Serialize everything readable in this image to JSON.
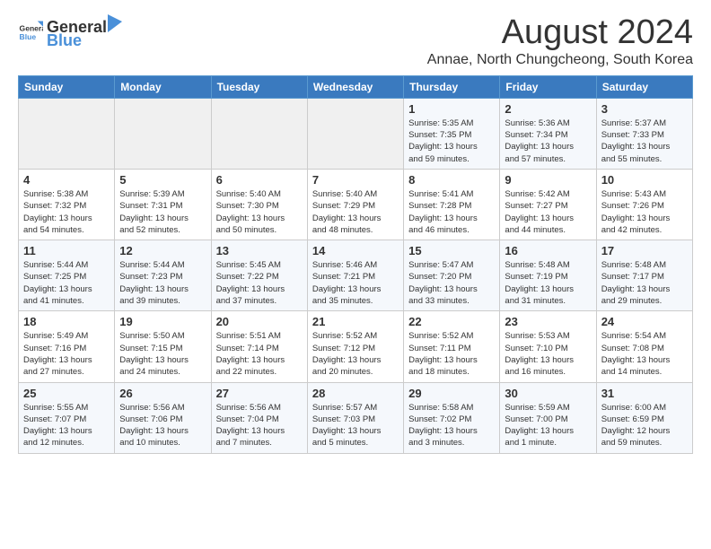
{
  "header": {
    "logo_general": "General",
    "logo_blue": "Blue",
    "month_title": "August 2024",
    "location": "Annae, North Chungcheong, South Korea"
  },
  "weekdays": [
    "Sunday",
    "Monday",
    "Tuesday",
    "Wednesday",
    "Thursday",
    "Friday",
    "Saturday"
  ],
  "weeks": [
    [
      {
        "day": "",
        "info": ""
      },
      {
        "day": "",
        "info": ""
      },
      {
        "day": "",
        "info": ""
      },
      {
        "day": "",
        "info": ""
      },
      {
        "day": "1",
        "info": "Sunrise: 5:35 AM\nSunset: 7:35 PM\nDaylight: 13 hours\nand 59 minutes."
      },
      {
        "day": "2",
        "info": "Sunrise: 5:36 AM\nSunset: 7:34 PM\nDaylight: 13 hours\nand 57 minutes."
      },
      {
        "day": "3",
        "info": "Sunrise: 5:37 AM\nSunset: 7:33 PM\nDaylight: 13 hours\nand 55 minutes."
      }
    ],
    [
      {
        "day": "4",
        "info": "Sunrise: 5:38 AM\nSunset: 7:32 PM\nDaylight: 13 hours\nand 54 minutes."
      },
      {
        "day": "5",
        "info": "Sunrise: 5:39 AM\nSunset: 7:31 PM\nDaylight: 13 hours\nand 52 minutes."
      },
      {
        "day": "6",
        "info": "Sunrise: 5:40 AM\nSunset: 7:30 PM\nDaylight: 13 hours\nand 50 minutes."
      },
      {
        "day": "7",
        "info": "Sunrise: 5:40 AM\nSunset: 7:29 PM\nDaylight: 13 hours\nand 48 minutes."
      },
      {
        "day": "8",
        "info": "Sunrise: 5:41 AM\nSunset: 7:28 PM\nDaylight: 13 hours\nand 46 minutes."
      },
      {
        "day": "9",
        "info": "Sunrise: 5:42 AM\nSunset: 7:27 PM\nDaylight: 13 hours\nand 44 minutes."
      },
      {
        "day": "10",
        "info": "Sunrise: 5:43 AM\nSunset: 7:26 PM\nDaylight: 13 hours\nand 42 minutes."
      }
    ],
    [
      {
        "day": "11",
        "info": "Sunrise: 5:44 AM\nSunset: 7:25 PM\nDaylight: 13 hours\nand 41 minutes."
      },
      {
        "day": "12",
        "info": "Sunrise: 5:44 AM\nSunset: 7:23 PM\nDaylight: 13 hours\nand 39 minutes."
      },
      {
        "day": "13",
        "info": "Sunrise: 5:45 AM\nSunset: 7:22 PM\nDaylight: 13 hours\nand 37 minutes."
      },
      {
        "day": "14",
        "info": "Sunrise: 5:46 AM\nSunset: 7:21 PM\nDaylight: 13 hours\nand 35 minutes."
      },
      {
        "day": "15",
        "info": "Sunrise: 5:47 AM\nSunset: 7:20 PM\nDaylight: 13 hours\nand 33 minutes."
      },
      {
        "day": "16",
        "info": "Sunrise: 5:48 AM\nSunset: 7:19 PM\nDaylight: 13 hours\nand 31 minutes."
      },
      {
        "day": "17",
        "info": "Sunrise: 5:48 AM\nSunset: 7:17 PM\nDaylight: 13 hours\nand 29 minutes."
      }
    ],
    [
      {
        "day": "18",
        "info": "Sunrise: 5:49 AM\nSunset: 7:16 PM\nDaylight: 13 hours\nand 27 minutes."
      },
      {
        "day": "19",
        "info": "Sunrise: 5:50 AM\nSunset: 7:15 PM\nDaylight: 13 hours\nand 24 minutes."
      },
      {
        "day": "20",
        "info": "Sunrise: 5:51 AM\nSunset: 7:14 PM\nDaylight: 13 hours\nand 22 minutes."
      },
      {
        "day": "21",
        "info": "Sunrise: 5:52 AM\nSunset: 7:12 PM\nDaylight: 13 hours\nand 20 minutes."
      },
      {
        "day": "22",
        "info": "Sunrise: 5:52 AM\nSunset: 7:11 PM\nDaylight: 13 hours\nand 18 minutes."
      },
      {
        "day": "23",
        "info": "Sunrise: 5:53 AM\nSunset: 7:10 PM\nDaylight: 13 hours\nand 16 minutes."
      },
      {
        "day": "24",
        "info": "Sunrise: 5:54 AM\nSunset: 7:08 PM\nDaylight: 13 hours\nand 14 minutes."
      }
    ],
    [
      {
        "day": "25",
        "info": "Sunrise: 5:55 AM\nSunset: 7:07 PM\nDaylight: 13 hours\nand 12 minutes."
      },
      {
        "day": "26",
        "info": "Sunrise: 5:56 AM\nSunset: 7:06 PM\nDaylight: 13 hours\nand 10 minutes."
      },
      {
        "day": "27",
        "info": "Sunrise: 5:56 AM\nSunset: 7:04 PM\nDaylight: 13 hours\nand 7 minutes."
      },
      {
        "day": "28",
        "info": "Sunrise: 5:57 AM\nSunset: 7:03 PM\nDaylight: 13 hours\nand 5 minutes."
      },
      {
        "day": "29",
        "info": "Sunrise: 5:58 AM\nSunset: 7:02 PM\nDaylight: 13 hours\nand 3 minutes."
      },
      {
        "day": "30",
        "info": "Sunrise: 5:59 AM\nSunset: 7:00 PM\nDaylight: 13 hours\nand 1 minute."
      },
      {
        "day": "31",
        "info": "Sunrise: 6:00 AM\nSunset: 6:59 PM\nDaylight: 12 hours\nand 59 minutes."
      }
    ]
  ]
}
